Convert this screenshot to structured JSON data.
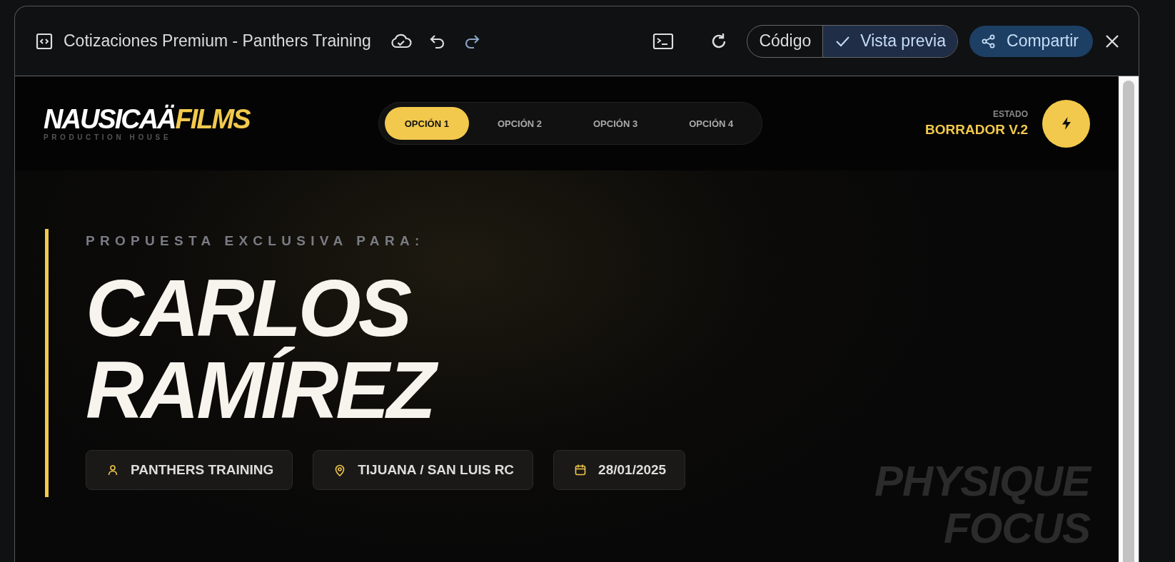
{
  "window": {
    "title": "Cotizaciones Premium - Panthers Training"
  },
  "view_toggle": [
    {
      "label": "Código",
      "selected": false
    },
    {
      "label": "Vista previa",
      "selected": true
    }
  ],
  "share_button": {
    "label": "Compartir"
  },
  "preview": {
    "brand": {
      "name": "NAUSICAÄ",
      "highlight": "FILMS",
      "tagline": "PRODUCTION HOUSE"
    },
    "options": [
      {
        "label": "OPCIÓN 1",
        "selected": true
      },
      {
        "label": "OPCIÓN 2",
        "selected": false
      },
      {
        "label": "OPCIÓN 3",
        "selected": false
      },
      {
        "label": "OPCIÓN 4",
        "selected": false
      }
    ],
    "status": {
      "label": "ESTADO",
      "value": "BORRADOR V.2"
    },
    "hero": {
      "eyebrow": "PROPUESTA EXCLUSIVA PARA:",
      "name_lines": [
        "CARLOS",
        "RAMÍREZ"
      ],
      "chips": [
        {
          "kind": "person",
          "text": "PANTHERS TRAINING"
        },
        {
          "kind": "location",
          "text": "TIJUANA / SAN LUIS RC"
        },
        {
          "kind": "date",
          "text": "28/01/2025"
        }
      ],
      "backdrop_lines": [
        "PHYSIQUE",
        "FOCUS"
      ]
    }
  }
}
